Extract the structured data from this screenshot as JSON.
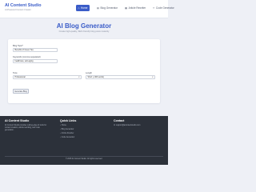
{
  "brand": {
    "title": "AI Content Studio",
    "tagline": "AI-Powered Content Creator"
  },
  "nav": {
    "items": [
      {
        "icon": "⌂",
        "label": "Home",
        "active": true
      },
      {
        "icon": "▤",
        "label": "Blog Generator",
        "active": false
      },
      {
        "icon": "▦",
        "label": "Article Rewriter",
        "active": false
      },
      {
        "icon": "‹›",
        "label": "Code Generator",
        "active": false
      }
    ]
  },
  "hero": {
    "title": "AI Blog Generator",
    "subtitle": "Create high-quality, SEO-friendly blog posts instantly"
  },
  "form": {
    "topic_label": "Blog Topic*",
    "topic_value": "Benefits of Green Tea",
    "keywords_label": "Keywords (comma separated)",
    "keywords_value": "healthcare, anti-aging",
    "tone_label": "Tone",
    "tone_value": "Professional",
    "length_label": "Length",
    "length_value": "Short (~300 words)",
    "generate_label": "Generate Blog"
  },
  "footer": {
    "about_title": "AI Content Studio",
    "about_text": "AI Content Studio provides cutting-edge AI tools for content creation, article rewriting, and code generation.",
    "links_title": "Quick Links",
    "links": [
      "Home",
      "Blog Generator",
      "Article Rewriter",
      "Code Generator"
    ],
    "contact_title": "Contact",
    "contact_email": "support@aicontentstudio.com",
    "copyright": "© 2025 AI Content Studio. All rights reserved."
  }
}
